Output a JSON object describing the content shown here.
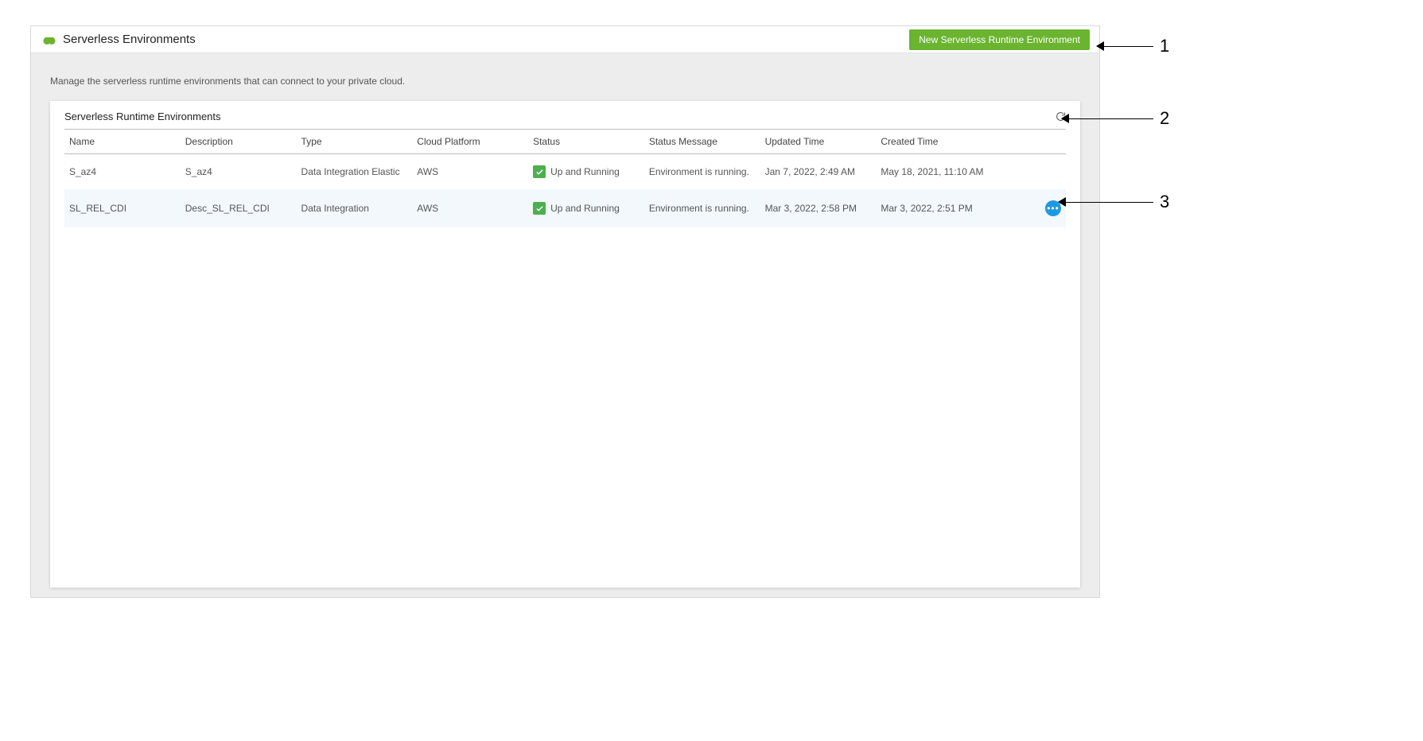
{
  "header": {
    "title": "Serverless Environments",
    "newButton": "New Serverless Runtime Environment"
  },
  "subtitle": "Manage the serverless runtime environments that can connect to your private cloud.",
  "panel": {
    "title": "Serverless Runtime Environments"
  },
  "columns": {
    "name": "Name",
    "description": "Description",
    "type": "Type",
    "cloudPlatform": "Cloud Platform",
    "status": "Status",
    "statusMessage": "Status Message",
    "updatedTime": "Updated Time",
    "createdTime": "Created Time"
  },
  "rows": [
    {
      "name": "S_az4",
      "description": "S_az4",
      "type": "Data Integration Elastic",
      "cloudPlatform": "AWS",
      "status": "Up and Running",
      "statusMessage": "Environment is running.",
      "updatedTime": "Jan 7, 2022, 2:49 AM",
      "createdTime": "May 18, 2021, 11:10 AM"
    },
    {
      "name": "SL_REL_CDI",
      "description": "Desc_SL_REL_CDI",
      "type": "Data Integration",
      "cloudPlatform": "AWS",
      "status": "Up and Running",
      "statusMessage": "Environment is running.",
      "updatedTime": "Mar 3, 2022, 2:58 PM",
      "createdTime": "Mar 3, 2022, 2:51 PM"
    }
  ],
  "callouts": {
    "c1": "1",
    "c2": "2",
    "c3": "3"
  }
}
